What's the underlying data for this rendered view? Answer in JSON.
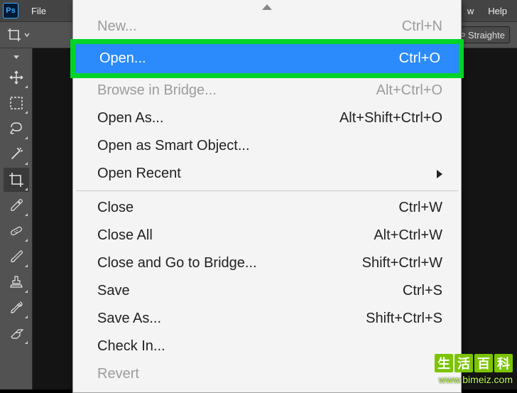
{
  "app": {
    "logo_text": "Ps"
  },
  "menubar": {
    "file": "File",
    "right1": "w",
    "right2": "Help"
  },
  "options": {
    "straighten": "Straighte"
  },
  "file_menu": {
    "items": [
      {
        "id": "new",
        "label": "New...",
        "shortcut": "Ctrl+N",
        "disabled": true
      },
      {
        "id": "open",
        "label": "Open...",
        "shortcut": "Ctrl+O",
        "highlighted": true
      },
      {
        "id": "browse",
        "label": "Browse in Bridge...",
        "shortcut": "Alt+Ctrl+O",
        "disabled": true
      },
      {
        "id": "openas",
        "label": "Open As...",
        "shortcut": "Alt+Shift+Ctrl+O"
      },
      {
        "id": "opensmart",
        "label": "Open as Smart Object..."
      },
      {
        "id": "openrecent",
        "label": "Open Recent",
        "submenu": true
      },
      {
        "sep": true
      },
      {
        "id": "close",
        "label": "Close",
        "shortcut": "Ctrl+W"
      },
      {
        "id": "closeall",
        "label": "Close All",
        "shortcut": "Alt+Ctrl+W"
      },
      {
        "id": "closegtb",
        "label": "Close and Go to Bridge...",
        "shortcut": "Shift+Ctrl+W"
      },
      {
        "id": "save",
        "label": "Save",
        "shortcut": "Ctrl+S"
      },
      {
        "id": "saveas",
        "label": "Save As...",
        "shortcut": "Shift+Ctrl+S"
      },
      {
        "id": "checkin",
        "label": "Check In..."
      },
      {
        "id": "revert",
        "label": "Revert",
        "disabled": true
      }
    ]
  },
  "watermark": {
    "chars": [
      "生",
      "活",
      "百",
      "科"
    ],
    "url": "www.bimeiz.com"
  }
}
